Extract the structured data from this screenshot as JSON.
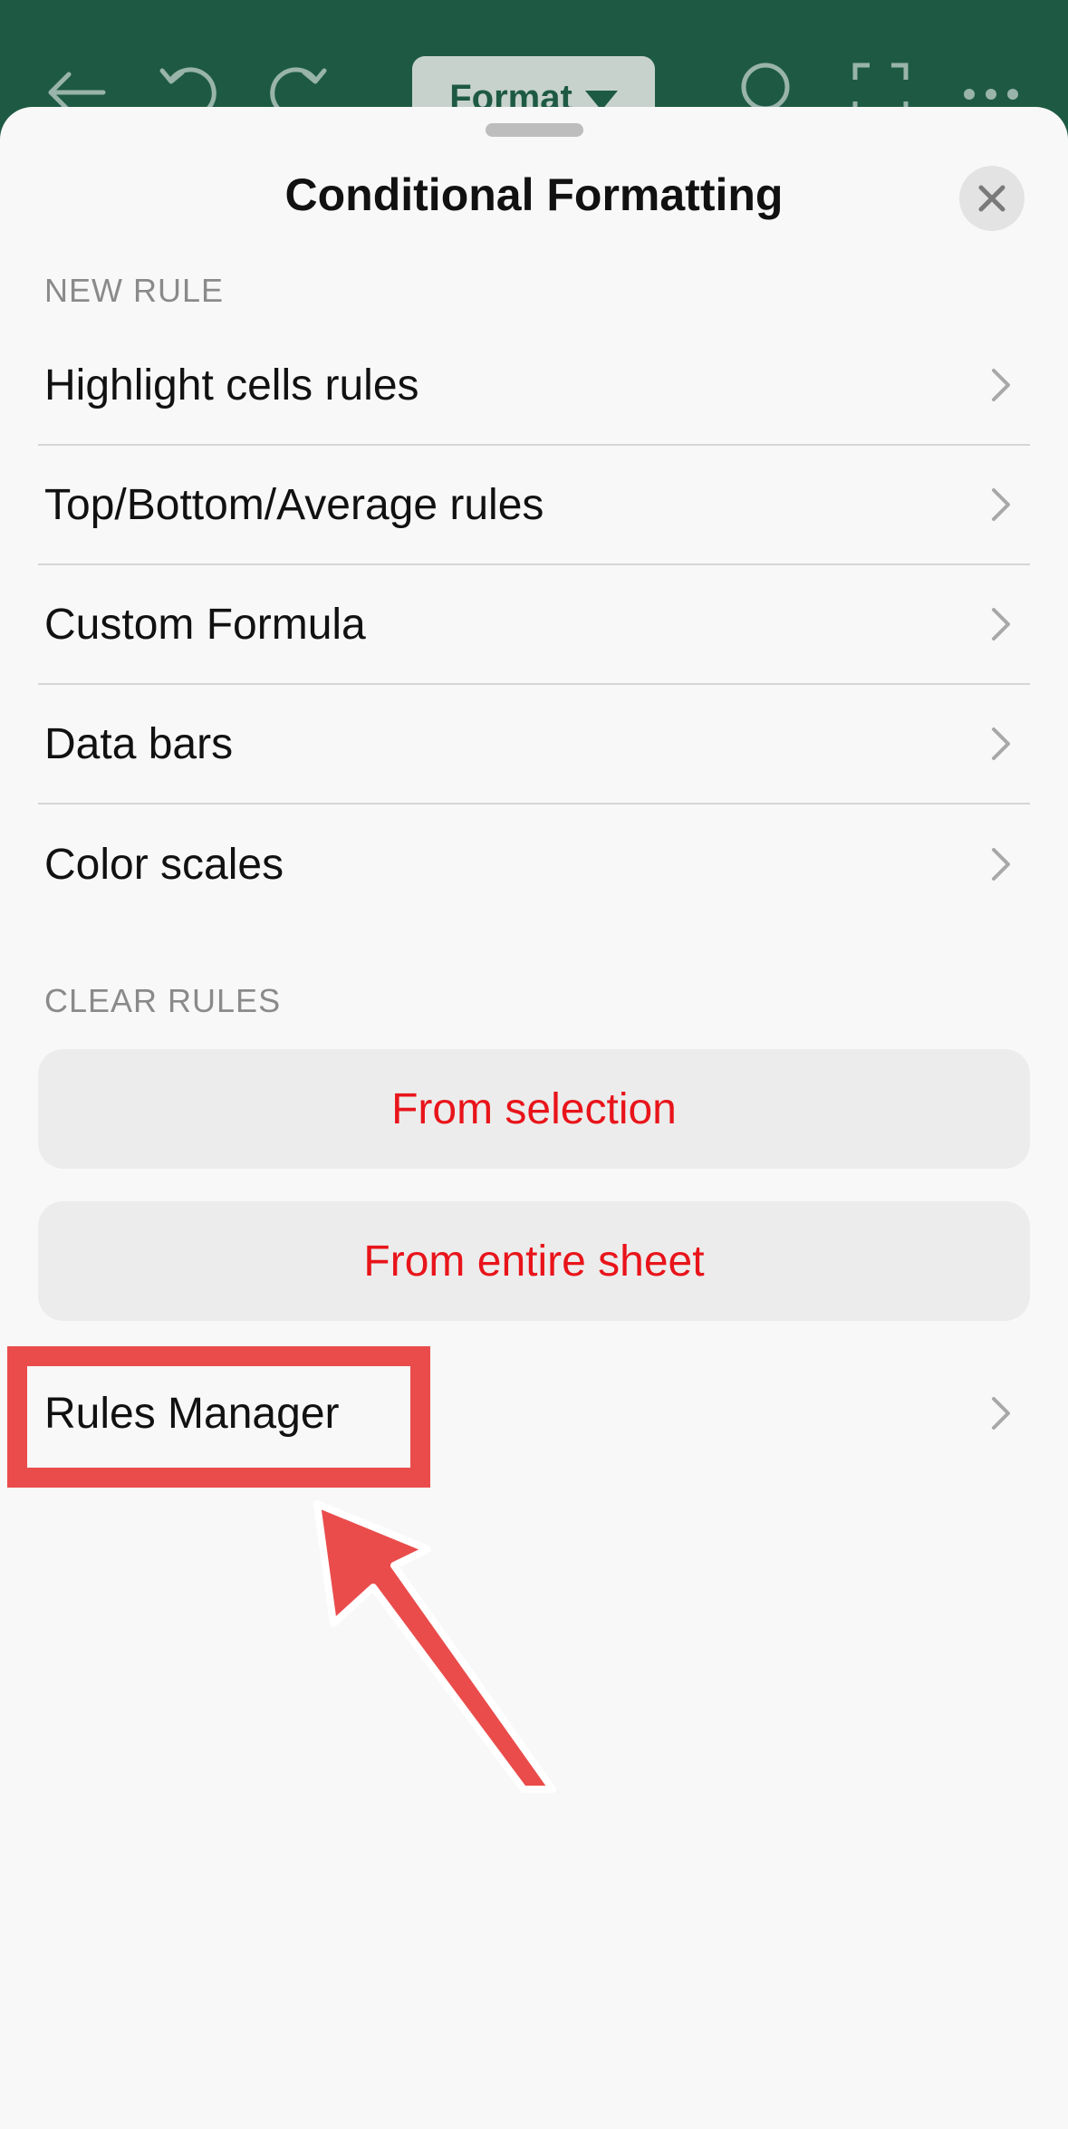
{
  "topbar": {
    "format_label": "Format",
    "icons": [
      "back-arrow-icon",
      "undo-icon",
      "redo-icon",
      "search-icon",
      "fullscreen-icon",
      "more-icon"
    ]
  },
  "sheet": {
    "title": "Conditional Formatting",
    "close_icon": "close-icon",
    "new_rule_section": "NEW RULE",
    "new_rule_items": [
      {
        "label": "Highlight cells rules"
      },
      {
        "label": "Top/Bottom/Average rules"
      },
      {
        "label": "Custom Formula"
      },
      {
        "label": "Data bars"
      },
      {
        "label": "Color scales"
      }
    ],
    "clear_rules_section": "CLEAR RULES",
    "clear_buttons": [
      {
        "label": "From selection"
      },
      {
        "label": "From entire sheet"
      }
    ],
    "rules_manager_label": "Rules Manager"
  },
  "colors": {
    "header_green": "#1e5a43",
    "destructive_red": "#e8141a",
    "annotation_red": "#ea4c4c"
  }
}
